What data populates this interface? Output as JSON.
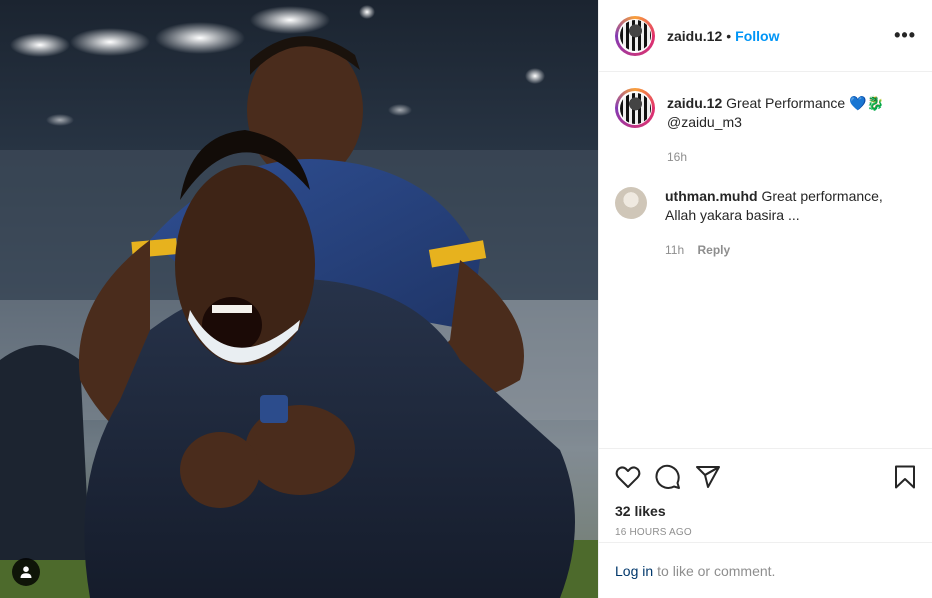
{
  "post": {
    "username": "zaidu.12",
    "follow_label": "Follow",
    "dot": "•",
    "more_label": "•••"
  },
  "caption": {
    "username": "zaidu.12",
    "text": "Great Performance 💙🐉",
    "mention": "@zaidu_m3",
    "time": "16h"
  },
  "comments": [
    {
      "username": "uthman.muhd",
      "text": "Great performance,",
      "text2": "Allah yakara basira ...",
      "time": "11h",
      "reply_label": "Reply"
    }
  ],
  "actions": {
    "likes": "32 likes",
    "time_ago": "16 HOURS AGO"
  },
  "login": {
    "link": "Log in",
    "text": "to like or comment."
  },
  "icons": {
    "like": "heart-icon",
    "comment": "comment-icon",
    "share": "share-icon",
    "save": "bookmark-icon",
    "tag": "user-tag-icon"
  },
  "colors": {
    "accent": "#0095f6",
    "link": "#00376b",
    "muted": "#8e8e8e",
    "border": "#efefef"
  }
}
